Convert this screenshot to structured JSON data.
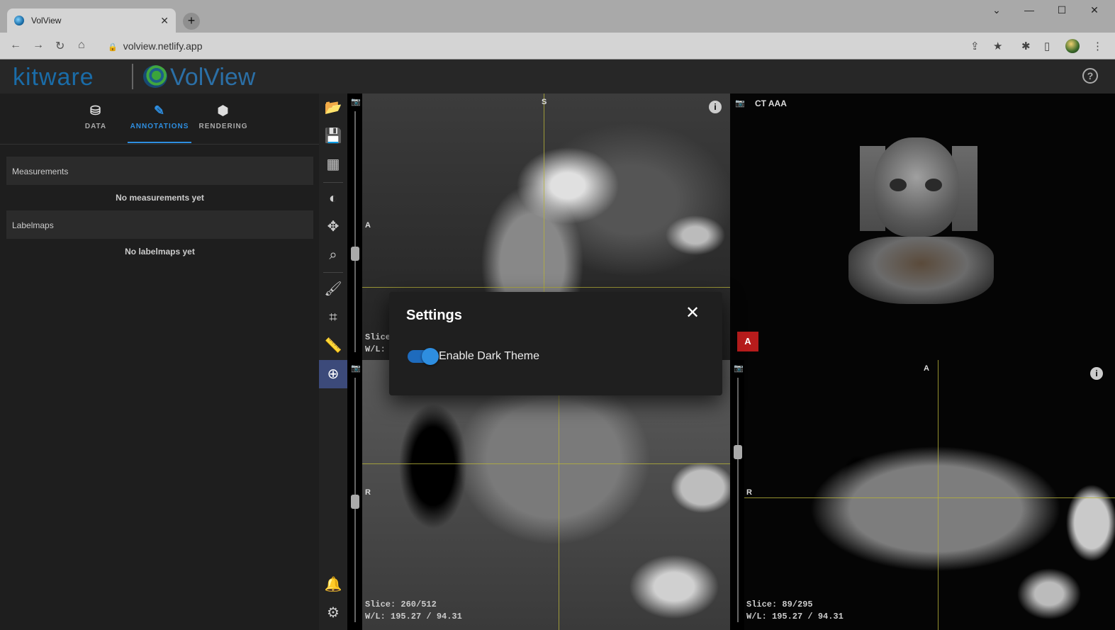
{
  "browser": {
    "tab_title": "VolView",
    "tab_close": "✕",
    "new_tab": "+",
    "url": "volview.netlify.app"
  },
  "app": {
    "logo_kitware": "kitware",
    "logo_volview": "VolView",
    "help": "?"
  },
  "left_panel": {
    "tabs": [
      {
        "label": "DATA",
        "icon": "database-icon"
      },
      {
        "label": "ANNOTATIONS",
        "icon": "pencil-icon"
      },
      {
        "label": "RENDERING",
        "icon": "cube-icon"
      }
    ],
    "active_tab": "ANNOTATIONS",
    "sections": [
      {
        "header": "Measurements",
        "empty": "No measurements yet"
      },
      {
        "header": "Labelmaps",
        "empty": "No labelmaps yet"
      }
    ]
  },
  "toolbar": {
    "tools": [
      "folder-open-icon",
      "save-icon",
      "layout-icon",
      "window-level-icon",
      "pan-icon",
      "zoom-icon",
      "paint-icon",
      "crop-icon",
      "ruler-icon",
      "crosshairs-icon"
    ],
    "active_tool": "crosshairs-icon",
    "bottom": [
      "bell-icon",
      "gear-icon"
    ]
  },
  "views": {
    "top_left": {
      "orient_top": "S",
      "orient_left": "A",
      "slice_partial": "Slice: ",
      "wl_partial": "W/L: "
    },
    "top_right": {
      "label": "CT AAA",
      "badge": "A"
    },
    "bottom_left": {
      "orient_left": "R",
      "slice": "Slice: 260/512",
      "wl": "W/L: 195.27 / 94.31"
    },
    "bottom_right": {
      "orient_top": "A",
      "orient_left": "R",
      "slice": "Slice: 89/295",
      "wl": "W/L: 195.27 / 94.31"
    }
  },
  "dialog": {
    "title": "Settings",
    "close": "✕",
    "toggle_label": "Enable Dark Theme",
    "toggle_on": true
  },
  "colors": {
    "accent": "#2e8ee0",
    "crosshair": "#b7b13a",
    "badge": "#b71c1c"
  }
}
